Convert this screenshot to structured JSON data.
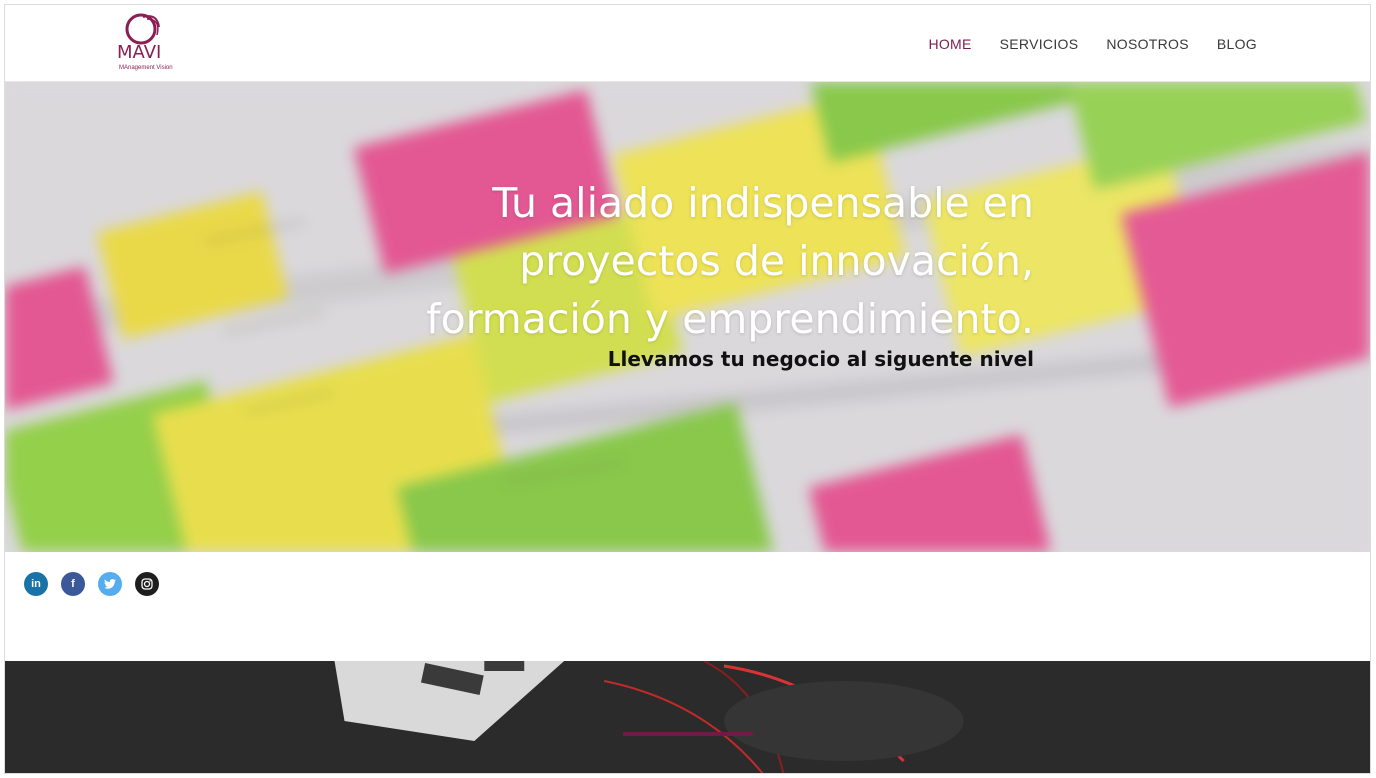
{
  "brand": {
    "logo_text": "MAVI",
    "logo_tagline": "MAnagement Vision",
    "color": "#7a1e4f"
  },
  "nav": {
    "items": [
      {
        "label": "HOME",
        "active": true
      },
      {
        "label": "SERVICIOS",
        "active": false
      },
      {
        "label": "NOSOTROS",
        "active": false
      },
      {
        "label": "BLOG",
        "active": false
      }
    ]
  },
  "hero": {
    "title_lines": [
      "Tu aliado indispensable en",
      "proyectos de innovación,",
      "formación y emprendimiento."
    ],
    "subtitle": "Llevamos tu negocio al siguente nivel"
  },
  "social": [
    {
      "name": "linkedin-icon",
      "glyph": "in"
    },
    {
      "name": "facebook-icon",
      "glyph": "f"
    },
    {
      "name": "twitter-icon",
      "glyph": "t"
    },
    {
      "name": "instagram-icon",
      "glyph": "◎"
    }
  ],
  "colors": {
    "accent": "#6e1b48",
    "nav_text": "#3a3a3a"
  }
}
